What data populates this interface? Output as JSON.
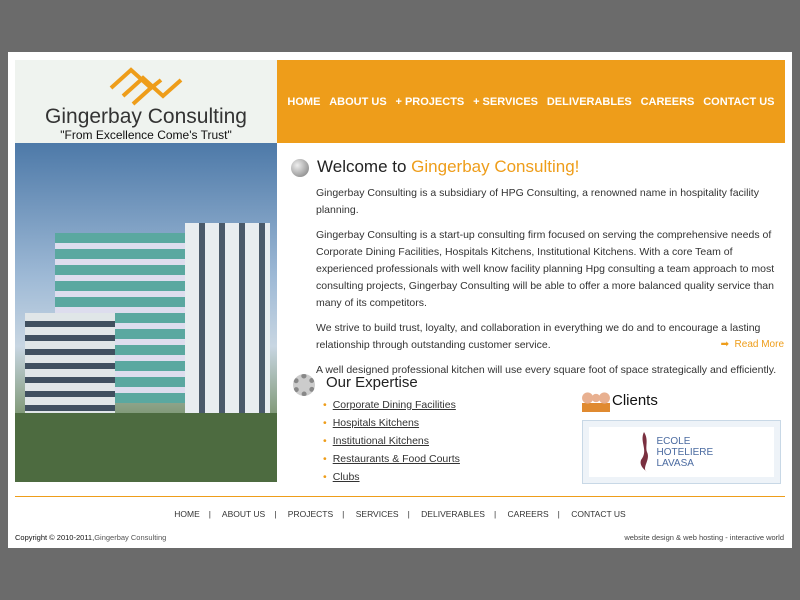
{
  "logo": {
    "name": "Gingerbay Consulting",
    "tagline": "\"From Excellence Come's Trust\""
  },
  "nav": [
    "HOME",
    "ABOUT US",
    "+ PROJECTS",
    "+ SERVICES",
    "DELIVERABLES",
    "CAREERS",
    "CONTACT US"
  ],
  "welcome": {
    "prefix": "Welcome to ",
    "brand": "Gingerbay Consulting!",
    "paragraphs": [
      "Gingerbay Consulting is a subsidiary of HPG Consulting, a renowned name in hospitality facility planning.",
      "Gingerbay Consulting is a start-up consulting firm focused on serving the comprehensive needs of Corporate Dining Facilities, Hospitals Kitchens, Institutional Kitchens. With a core Team of experienced professionals with well know facility planning Hpg consulting a team approach to most consulting projects, Gingerbay Consulting will be able to offer a more balanced quality service than many of its competitors.",
      "We strive to build trust, loyalty, and collaboration in everything we do and to encourage a lasting relationship through outstanding customer service.",
      "A well designed professional kitchen will use every square foot of space strategically and efficiently."
    ],
    "read_more": "Read More"
  },
  "expertise": {
    "title": "Our Expertise",
    "items": [
      "Corporate Dining Facilities",
      "Hospitals Kitchens",
      "Institutional Kitchens",
      "Restaurants & Food Courts",
      "Clubs"
    ]
  },
  "clients": {
    "title": "Clients",
    "logo_text": "ECOLE HOTELIERE LAVASA"
  },
  "footer": {
    "nav": [
      "HOME",
      "ABOUT US",
      "PROJECTS",
      "SERVICES",
      "DELIVERABLES",
      "CAREERS",
      "CONTACT US"
    ],
    "copyright": "Copyright © 2010-2011,",
    "company": "Gingerbay Consulting",
    "credit": "website design & web hosting - interactive world"
  },
  "colors": {
    "accent": "#ee9d1a",
    "background": "#6b6b6b"
  }
}
